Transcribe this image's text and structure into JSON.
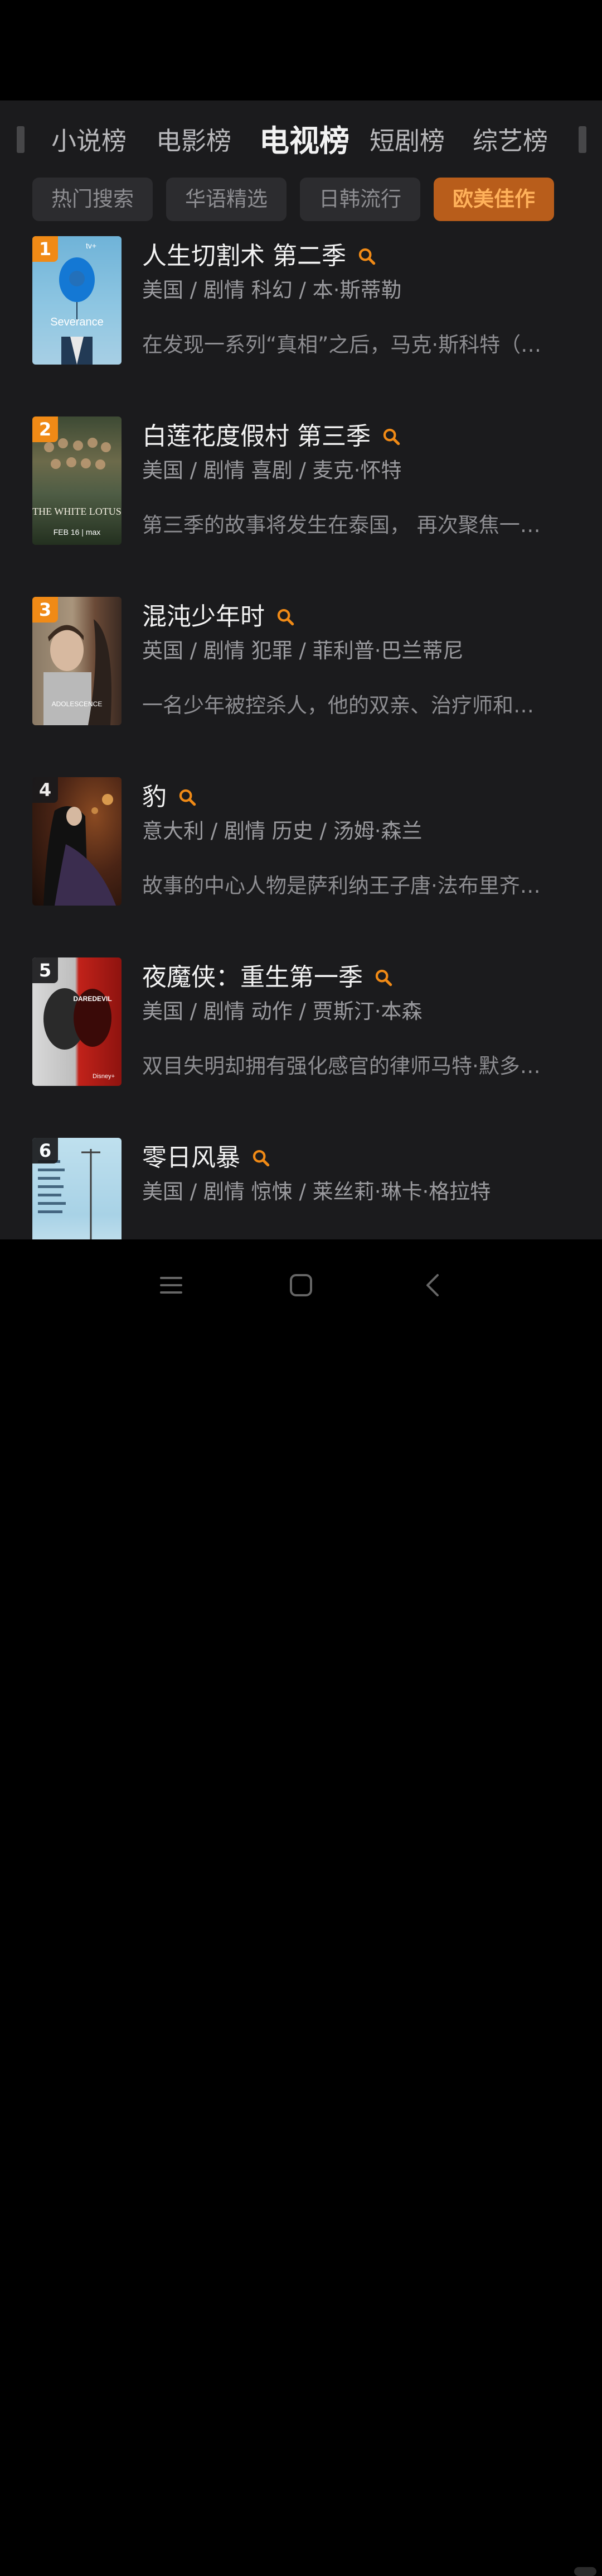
{
  "colors": {
    "accent": "#f08a16",
    "panel_bg": "#1b1b1d",
    "active_pill_bg": "#b85d1b",
    "active_pill_text": "#ffb15a"
  },
  "category_tabs": [
    "小说榜",
    "电影榜",
    "电视榜",
    "短剧榜",
    "综艺榜"
  ],
  "active_category": "电视榜",
  "filter_pills": [
    "热门搜索",
    "华语精选",
    "日韩流行",
    "欧美佳作"
  ],
  "active_pill": "欧美佳作",
  "items": [
    {
      "rank": "1",
      "title": "人生切割术 第二季",
      "meta": "美国 / 剧情 科幻 / 本·斯蒂勒",
      "desc": "在发现一系列“真相”之后，马克·斯科特（…",
      "poster_text": "Severance",
      "poster_top": "tv+"
    },
    {
      "rank": "2",
      "title": "白莲花度假村 第三季",
      "meta": "美国 / 剧情 喜剧 / 麦克·怀特",
      "desc": "第三季的故事将发生在泰国， 再次聚焦一…",
      "poster_text": "THE WHITE LOTUS",
      "poster_top": "FEB 16 | max"
    },
    {
      "rank": "3",
      "title": "混沌少年时",
      "meta": "英国 / 剧情 犯罪 / 菲利普·巴兰蒂尼",
      "desc": "一名少年被控杀人，他的双亲、治疗师和…",
      "poster_text": "ADOLESCENCE",
      "poster_top": ""
    },
    {
      "rank": "4",
      "title": "豹",
      "meta": "意大利 / 剧情 历史 / 汤姆·森兰",
      "desc": "故事的中心人物是萨利纳王子唐·法布里齐…",
      "poster_text": "",
      "poster_top": ""
    },
    {
      "rank": "5",
      "title": "夜魔侠：重生第一季",
      "meta": "美国 / 剧情 动作 / 贾斯汀·本森",
      "desc": "双目失明却拥有强化感官的律师马特·默多…",
      "poster_text": "DAREDEVIL",
      "poster_top": "Disney+"
    },
    {
      "rank": "6",
      "title": "零日风暴",
      "meta": "美国 / 剧情 惊悚 / 莱丝莉·琳卡·格拉特",
      "desc": "",
      "poster_text": "",
      "poster_top": ""
    }
  ],
  "nav": {
    "menu": "menu-icon",
    "home": "square-icon",
    "back": "back-icon"
  }
}
